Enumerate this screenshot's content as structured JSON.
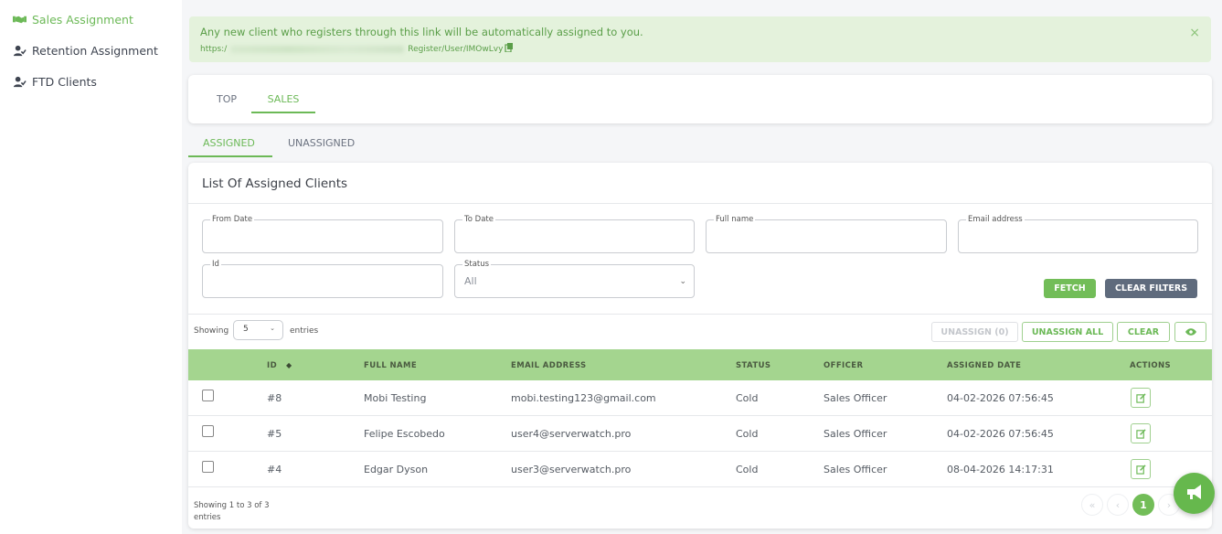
{
  "sidebar": {
    "items": [
      {
        "label": "Sales Assignment",
        "icon": "handshake-icon",
        "active": true
      },
      {
        "label": "Retention Assignment",
        "icon": "user-check-icon",
        "active": false
      },
      {
        "label": "FTD Clients",
        "icon": "user-check-icon",
        "active": false
      }
    ]
  },
  "alert": {
    "message": "Any new client who registers through this link will be automatically assigned to you.",
    "link_prefix": "https:/",
    "link_suffix": "Register/User/IMOwLvy",
    "close": "×"
  },
  "tabs": {
    "top": "TOP",
    "sales": "SALES"
  },
  "subtabs": {
    "assigned": "ASSIGNED",
    "unassigned": "UNASSIGNED"
  },
  "card": {
    "title": "List Of Assigned Clients"
  },
  "filters": {
    "from_date": {
      "label": "From Date",
      "value": ""
    },
    "to_date": {
      "label": "To Date",
      "value": ""
    },
    "full_name": {
      "label": "Full name",
      "value": ""
    },
    "email": {
      "label": "Email address",
      "value": ""
    },
    "id": {
      "label": "Id",
      "value": ""
    },
    "status": {
      "label": "Status",
      "value": "All"
    },
    "fetch": "FETCH",
    "clear_filters": "CLEAR FILTERS"
  },
  "table_controls": {
    "showing": "Showing",
    "entries_value": "5",
    "entries": "entries",
    "unassign": "UNASSIGN (0)",
    "unassign_all": "UNASSIGN ALL",
    "clear": "CLEAR"
  },
  "table": {
    "headers": {
      "id": "ID",
      "full_name": "FULL NAME",
      "email": "EMAIL ADDRESS",
      "status": "STATUS",
      "officer": "OFFICER",
      "assigned_date": "ASSIGNED DATE",
      "actions": "ACTIONS"
    },
    "rows": [
      {
        "id": "#8",
        "name": "Mobi Testing",
        "email": "mobi.testing123@gmail.com",
        "status": "Cold",
        "officer": "Sales Officer",
        "date": "04-02-2026 07:56:45"
      },
      {
        "id": "#5",
        "name": "Felipe Escobedo",
        "email": "user4@serverwatch.pro",
        "status": "Cold",
        "officer": "Sales Officer",
        "date": "04-02-2026 07:56:45"
      },
      {
        "id": "#4",
        "name": "Edgar Dyson",
        "email": "user3@serverwatch.pro",
        "status": "Cold",
        "officer": "Sales Officer",
        "date": "08-04-2026 14:17:31"
      }
    ]
  },
  "footer": {
    "info_line1": "Showing 1 to 3 of 3",
    "info_line2": "entries",
    "first": "«",
    "prev": "‹",
    "current_page": "1",
    "next": "›"
  },
  "colors": {
    "accent": "#6cb957",
    "table_header": "#a4d58f",
    "alert_bg": "#e4f2dc",
    "dark_button": "#5f6b7d"
  }
}
